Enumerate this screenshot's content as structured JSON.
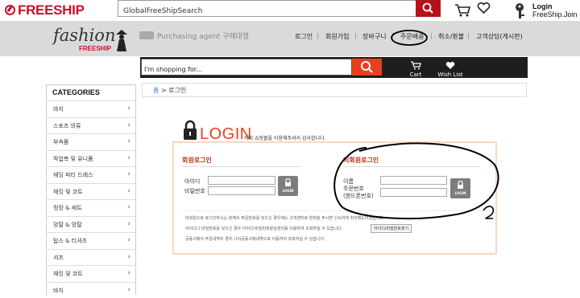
{
  "topbar": {
    "logo": "FREESHIP",
    "search_value": "GlobalFreeShipSearch",
    "login_label": "Login",
    "join_label": "FreeShip.Join"
  },
  "header": {
    "brand": "fashion",
    "brand_sub": "FREESHIP",
    "purchasing_agent": "Purchasing agent 구매대행",
    "nav": [
      "로그인",
      "회원가입",
      "장바구니",
      "주문배송",
      "취소/환불",
      "고객상담(게시판)"
    ],
    "separator": "|"
  },
  "navbar": {
    "search_placeholder": "I'm shopping for...",
    "cart_label": "Cart",
    "wishlist_label": "Wish List"
  },
  "sidebar": {
    "title": "CATEGORIES",
    "items": [
      "바지",
      "스포츠 의류",
      "부속품",
      "작업복 및 유니폼",
      "웨딩 파티 드레스",
      "재킷 및 코트",
      "정장 & 세트",
      "망탈 & 망탈",
      "탑스 & 티셔츠",
      "셔츠",
      "재킷 및 코트",
      "바지"
    ],
    "chevron": "›"
  },
  "breadcrumb": {
    "home": "홈",
    "sep": ">",
    "current": "로그인"
  },
  "login": {
    "title": "LOGIN",
    "subtitle": "저희 쇼핑몰을 이용해주셔서 감사합니다.",
    "member_title": "회원로그인",
    "member_id_label": "아이디",
    "member_pw_label": "비밀번호",
    "nonmember_title": "비회원로그인",
    "name_label": "이름",
    "order_no_label": "주문번호",
    "phone_label": "(핸드폰번호)",
    "button_label": "LOGIN",
    "notes": [
      "비회원으로 로그인하시는 분께서 주문번호를 잊으신 경우에는 고객센터로 연락을 주시면 신속하게 처리해드리겠습니다.",
      "아이디나 비밀번호를 잊으신 경우 아이디/비밀번호분실센터를 이용하여 조회하실 수 있습니다.",
      "공동구매의 주문내역의 경우 나의공동구매내역으로 이동하여 조회하실 수 있습니다."
    ],
    "find_button": "아이디/비밀번호찾기"
  },
  "colors": {
    "brand_red": "#c8102e",
    "accent_orange": "#e8401c",
    "nav_dark": "#1e1e1e",
    "band_gray": "#dadada"
  }
}
